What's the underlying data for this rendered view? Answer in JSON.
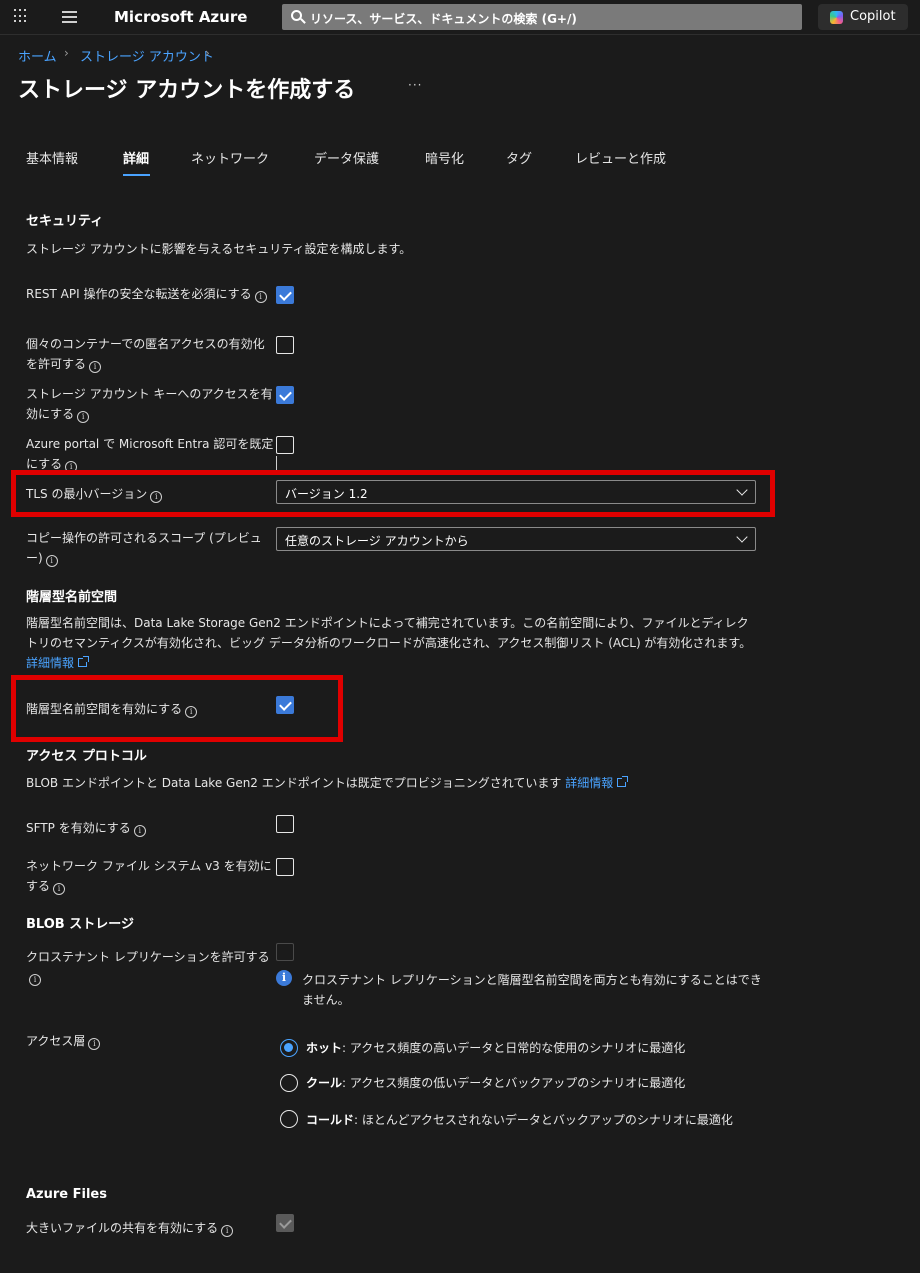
{
  "topbar": {
    "brand": "Microsoft Azure",
    "search_placeholder": "リソース、サービス、ドキュメントの検索 (G+/)",
    "copilot_label": "Copilot"
  },
  "breadcrumb": {
    "home": "ホーム",
    "storage": "ストレージ アカウント"
  },
  "page": {
    "title": "ストレージ アカウントを作成する",
    "more": "···"
  },
  "tabs": [
    {
      "label": "基本情報",
      "active": false
    },
    {
      "label": "詳細",
      "active": true
    },
    {
      "label": "ネットワーク",
      "active": false
    },
    {
      "label": "データ保護",
      "active": false
    },
    {
      "label": "暗号化",
      "active": false
    },
    {
      "label": "タグ",
      "active": false
    },
    {
      "label": "レビューと作成",
      "active": false
    }
  ],
  "security": {
    "heading": "セキュリティ",
    "description": "ストレージ アカウントに影響を与えるセキュリティ設定を構成します。",
    "secure_transfer": {
      "label": "REST API 操作の安全な転送を必須にする",
      "checked": true
    },
    "anonymous_access": {
      "label": "個々のコンテナーでの匿名アクセスの有効化を許可する",
      "checked": false
    },
    "key_access": {
      "label": "ストレージ アカウント キーへのアクセスを有効にする",
      "checked": true
    },
    "entra_default": {
      "label": "Azure portal で Microsoft Entra 認可を既定にする",
      "checked": false
    },
    "tls": {
      "label": "TLS の最小バージョン",
      "value": "バージョン 1.2"
    },
    "copy_scope": {
      "label": "コピー操作の許可されるスコープ (プレビュー)",
      "value": "任意のストレージ アカウントから"
    }
  },
  "hns": {
    "heading": "階層型名前空間",
    "description": "階層型名前空間は、Data Lake Storage Gen2 エンドポイントによって補完されています。この名前空間により、ファイルとディレクトリのセマンティクスが有効化され、ビッグ データ分析のワークロードが高速化され、アクセス制御リスト (ACL) が有効化されます。",
    "link": "詳細情報",
    "enable": {
      "label": "階層型名前空間を有効にする",
      "checked": true
    }
  },
  "protocols": {
    "heading": "アクセス プロトコル",
    "description": "BLOB エンドポイントと Data Lake Gen2 エンドポイントは既定でプロビジョニングされています",
    "link": "詳細情報",
    "sftp": {
      "label": "SFTP を有効にする",
      "checked": false
    },
    "nfs": {
      "label": "ネットワーク ファイル システム v3 を有効にする",
      "checked": false
    }
  },
  "blob": {
    "heading": "BLOB ストレージ",
    "cross_tenant": {
      "label": "クロステナント レプリケーションを許可する",
      "checked": false,
      "disabled": true
    },
    "cross_tenant_note": "クロステナント レプリケーションと階層型名前空間を両方とも有効にすることはできません。",
    "access_tier": {
      "label": "アクセス層",
      "selected": "hot",
      "options": [
        {
          "name": "ホット",
          "desc": ": アクセス頻度の高いデータと日常的な使用のシナリオに最適化"
        },
        {
          "name": "クール",
          "desc": ": アクセス頻度の低いデータとバックアップのシナリオに最適化"
        },
        {
          "name": "コールド",
          "desc": ": ほとんどアクセスされないデータとバックアップのシナリオに最適化"
        }
      ]
    }
  },
  "files": {
    "heading": "Azure Files",
    "large_shares": {
      "label": "大きいファイルの共有を有効にする",
      "checked": true,
      "disabled": true
    }
  },
  "colors": {
    "accent": "#4aa3ff",
    "checkbox_on": "#3b7ad9",
    "highlight": "#e00000",
    "background": "#1b1b1b"
  }
}
